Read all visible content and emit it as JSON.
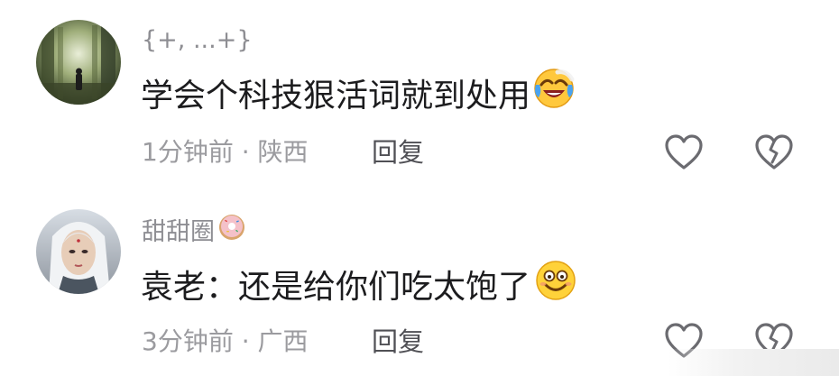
{
  "comments": [
    {
      "username": "{+, ...+}",
      "text": "学会个科技狠活词就到处用",
      "emoji": "laughing-tears-emoji",
      "time": "1分钟前",
      "separator": "·",
      "location": "陕西",
      "reply_label": "回复"
    },
    {
      "username": "甜甜圈",
      "username_badge": "donut-emoji",
      "text": "袁老：还是给你们吃太饱了",
      "emoji": "grinning-emoji",
      "time": "3分钟前",
      "separator": "·",
      "location": "广西",
      "reply_label": "回复"
    }
  ],
  "colors": {
    "text_primary": "#1c1c1e",
    "text_secondary": "#9b9b9f",
    "icon_stroke": "#6b6b70"
  }
}
